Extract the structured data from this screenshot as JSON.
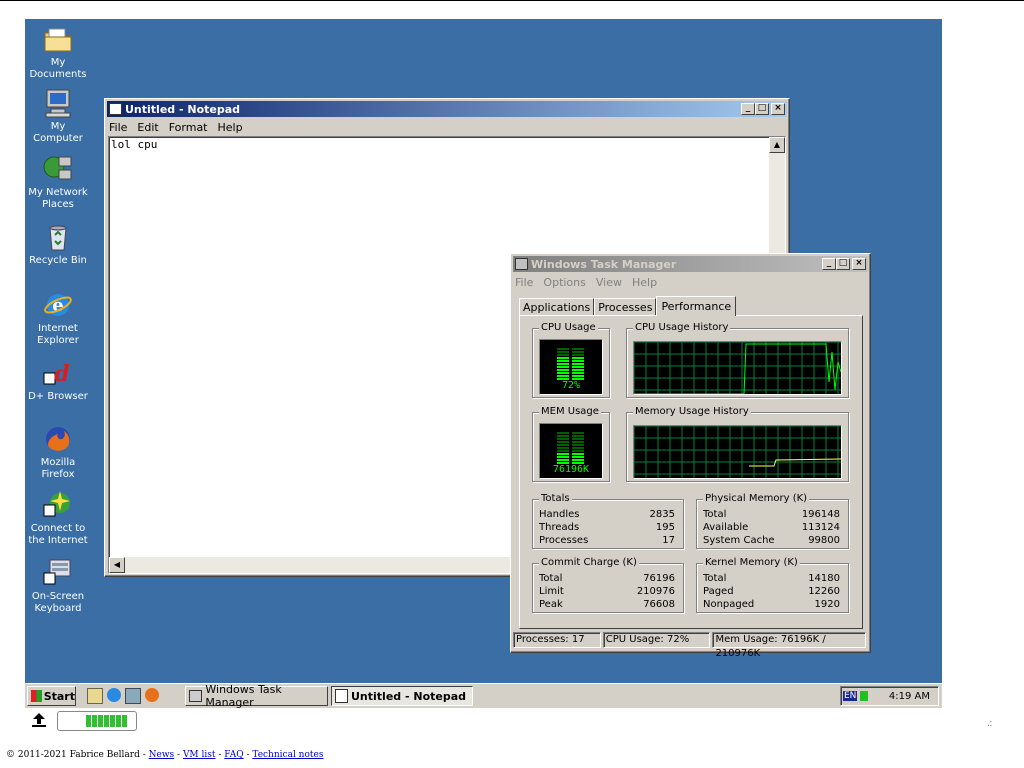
{
  "desktop_icons": [
    {
      "label": "My Documents"
    },
    {
      "label": "My Computer"
    },
    {
      "label": "My Network Places"
    },
    {
      "label": "Recycle Bin"
    },
    {
      "label": "Internet Explorer"
    },
    {
      "label": "D+ Browser"
    },
    {
      "label": "Mozilla Firefox"
    },
    {
      "label": "Connect to the Internet"
    },
    {
      "label": "On-Screen Keyboard"
    }
  ],
  "notepad": {
    "title": "Untitled - Notepad",
    "menu": [
      "File",
      "Edit",
      "Format",
      "Help"
    ],
    "content": "lol cpu"
  },
  "taskmgr": {
    "title": "Windows Task Manager",
    "menu": [
      "File",
      "Options",
      "View",
      "Help"
    ],
    "tabs": [
      "Applications",
      "Processes",
      "Performance"
    ],
    "active_tab": "Performance",
    "cpu_usage_label": "CPU Usage",
    "cpu_history_label": "CPU Usage History",
    "mem_usage_label": "MEM Usage",
    "mem_history_label": "Memory Usage History",
    "cpu_value": "72%",
    "cpu_fraction": 0.72,
    "mem_value": "76196K",
    "mem_fraction": 0.36,
    "totals": {
      "legend": "Totals",
      "rows": [
        [
          "Handles",
          "2835"
        ],
        [
          "Threads",
          "195"
        ],
        [
          "Processes",
          "17"
        ]
      ]
    },
    "physical": {
      "legend": "Physical Memory (K)",
      "rows": [
        [
          "Total",
          "196148"
        ],
        [
          "Available",
          "113124"
        ],
        [
          "System Cache",
          "99800"
        ]
      ]
    },
    "commit": {
      "legend": "Commit Charge (K)",
      "rows": [
        [
          "Total",
          "76196"
        ],
        [
          "Limit",
          "210976"
        ],
        [
          "Peak",
          "76608"
        ]
      ]
    },
    "kernel": {
      "legend": "Kernel Memory (K)",
      "rows": [
        [
          "Total",
          "14180"
        ],
        [
          "Paged",
          "12260"
        ],
        [
          "Nonpaged",
          "1920"
        ]
      ]
    },
    "status": {
      "processes": "Processes: 17",
      "cpu": "CPU Usage: 72%",
      "mem": "Mem Usage: 76196K / 210976K"
    }
  },
  "taskbar": {
    "start": "Start",
    "tasks": [
      {
        "label": "Windows Task Manager"
      },
      {
        "label": "Untitled - Notepad"
      }
    ],
    "lang": "EN",
    "clock": "4:19 AM"
  },
  "footer": {
    "copyright": "© 2011-2021 Fabrice Bellard - ",
    "links": [
      "News",
      "VM list",
      "FAQ",
      "Technical notes"
    ],
    "sep": " - "
  },
  "colors": {
    "desktop": "#3a6ea5",
    "graph_line": "#00ff00",
    "grid": "#008040"
  }
}
